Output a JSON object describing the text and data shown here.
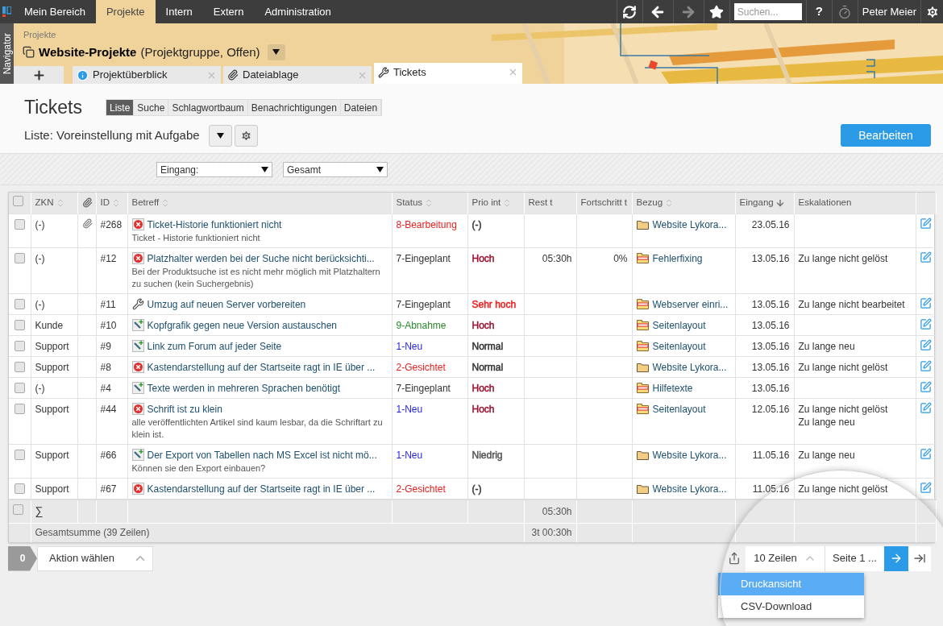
{
  "top_nav": {
    "items": [
      {
        "label": "Mein Bereich",
        "selected": false
      },
      {
        "label": "Projekte",
        "selected": true
      },
      {
        "label": "Intern",
        "selected": false
      },
      {
        "label": "Extern",
        "selected": false
      },
      {
        "label": "Administration",
        "selected": false
      }
    ],
    "forward_disabled": true,
    "timer_disabled": true,
    "search": {
      "placeholder": "Suchen..."
    },
    "help": "?",
    "user": "Peter Meier"
  },
  "navigator": "Navigator",
  "header": {
    "breadcrumb": "Projekte",
    "title": "Website-Projekte",
    "subtitle": "(Projektgruppe, Offen)",
    "tabs": [
      {
        "kind": "info",
        "label": "Projektüberblick",
        "selected": false
      },
      {
        "kind": "clip",
        "label": "Dateiablage",
        "selected": false
      },
      {
        "kind": "tools",
        "label": "Tickets",
        "selected": true
      }
    ]
  },
  "page": {
    "title": "Tickets",
    "view_tabs": [
      {
        "label": "Liste",
        "selected": true
      },
      {
        "label": "Suche",
        "selected": false
      },
      {
        "label": "Schlagwortbaum",
        "selected": false
      },
      {
        "label": "Benachrichtigungen",
        "selected": false
      },
      {
        "label": "Dateien",
        "selected": false
      }
    ],
    "list_label": "Liste: Voreinstellung mit Aufgabe",
    "edit_button": "Bearbeiten",
    "filters": [
      "Eingang:",
      "Gesamt"
    ]
  },
  "table": {
    "all_checked": false,
    "columns": [
      {
        "kind": "check"
      },
      {
        "kind": "sortable",
        "label": "ZKN",
        "sorted": false
      },
      {
        "kind": "clip"
      },
      {
        "kind": "sortable",
        "label": "ID",
        "sorted": false
      },
      {
        "kind": "sortable",
        "label": "Betreff",
        "sorted": false
      },
      {
        "kind": "sortable",
        "label": "Status",
        "sorted": false
      },
      {
        "kind": "sortable",
        "label": "Prio int",
        "sorted": false
      },
      {
        "kind": "text",
        "label": "Rest t"
      },
      {
        "kind": "text",
        "label": "Fortschritt t"
      },
      {
        "kind": "sortable",
        "label": "Bezug",
        "sorted": false
      },
      {
        "kind": "sortable",
        "label": "Eingang",
        "sorted": true
      },
      {
        "kind": "text",
        "label": "Eskalationen"
      },
      {
        "kind": "edit"
      }
    ],
    "rows": [
      {
        "checked": false,
        "zkn": "(-)",
        "attachment": true,
        "id": "#268",
        "kind": "error",
        "title": "Ticket-Historie funktioniert nicht",
        "description": "Ticket - Historie funktioniert nicht",
        "status": {
          "text": "8-Bearbeitung",
          "color": "#e8201f"
        },
        "prio": {
          "text": "(-)",
          "color": "#333333"
        },
        "bezug": {
          "kind": "folder",
          "text": "Website Lykora..."
        },
        "eingang": "23.05.16",
        "eskalationen": []
      },
      {
        "checked": false,
        "zkn": "(-)",
        "attachment": false,
        "id": "#12",
        "kind": "error",
        "title": "Platzhalter werden bei der Suche nicht berücksichti...",
        "description": "Bei der Produktsuche ist es nicht mehr möglich mit Platzhaltern zu suchen (kein Suchergebnis)",
        "status": {
          "text": "7-Eingeplant",
          "color": "#333333"
        },
        "prio": {
          "text": "Hoch",
          "color": "#9b1230"
        },
        "rest": "05:30h",
        "progress": "0%",
        "bezug": {
          "kind": "project",
          "text": "Fehlerfixing"
        },
        "eingang": "13.05.16",
        "eskalationen": [
          "Zu lange nicht gelöst"
        ]
      },
      {
        "checked": false,
        "zkn": "(-)",
        "attachment": false,
        "id": "#11",
        "kind": "tools",
        "title": "Umzug auf neuen Server vorbereiten",
        "status": {
          "text": "7-Eingeplant",
          "color": "#333333"
        },
        "prio": {
          "text": "Sehr hoch",
          "color": "#f0201f"
        },
        "bezug": {
          "kind": "project",
          "text": "Webserver einri..."
        },
        "eingang": "13.05.16",
        "eskalationen": [
          "Zu lange nicht bearbeitet"
        ]
      },
      {
        "checked": false,
        "zkn": "Kunde",
        "attachment": false,
        "id": "#10",
        "kind": "task",
        "title": "Kopfgrafik gegen neue Version austauschen",
        "status": {
          "text": "9-Abnahme",
          "color": "#2a8a2a"
        },
        "prio": {
          "text": "Hoch",
          "color": "#9b1230"
        },
        "bezug": {
          "kind": "project",
          "text": "Seitenlayout"
        },
        "eingang": "13.05.16",
        "eskalationen": []
      },
      {
        "checked": false,
        "zkn": "Support",
        "attachment": false,
        "id": "#9",
        "kind": "task",
        "title": "Link zum Forum auf jeder Seite",
        "status": {
          "text": "1-Neu",
          "color": "#1f1fe8"
        },
        "prio": {
          "text": "Normal",
          "color": "#333333"
        },
        "bezug": {
          "kind": "project",
          "text": "Seitenlayout"
        },
        "eingang": "13.05.16",
        "eskalationen": [
          "Zu lange neu"
        ]
      },
      {
        "checked": false,
        "zkn": "Support",
        "attachment": false,
        "id": "#8",
        "kind": "error",
        "title": "Kastendarstellung auf der Startseite ragt in IE über ...",
        "status": {
          "text": "2-Gesichtet",
          "color": "#e8201f"
        },
        "prio": {
          "text": "Normal",
          "color": "#333333"
        },
        "bezug": {
          "kind": "folder",
          "text": "Website Lykora..."
        },
        "eingang": "13.05.16",
        "eskalationen": [
          "Zu lange nicht gelöst"
        ]
      },
      {
        "checked": false,
        "zkn": "(-)",
        "attachment": false,
        "id": "#4",
        "kind": "task",
        "title": "Texte werden in mehreren Sprachen benötigt",
        "status": {
          "text": "7-Eingeplant",
          "color": "#333333"
        },
        "prio": {
          "text": "Hoch",
          "color": "#9b1230"
        },
        "bezug": {
          "kind": "project",
          "text": "Hilfetexte"
        },
        "eingang": "13.05.16",
        "eskalationen": []
      },
      {
        "checked": false,
        "zkn": "Support",
        "attachment": false,
        "id": "#44",
        "kind": "error",
        "title": "Schrift ist zu klein",
        "description": "alle veröffentlichten Artikel sind kaum lesbar, da die Schriftart zu klein ist.",
        "status": {
          "text": "1-Neu",
          "color": "#1f1fe8"
        },
        "prio": {
          "text": "Hoch",
          "color": "#9b1230"
        },
        "bezug": {
          "kind": "project",
          "text": "Seitenlayout"
        },
        "eingang": "12.05.16",
        "eskalationen": [
          "Zu lange nicht gelöst",
          "Zu lange neu"
        ]
      },
      {
        "checked": false,
        "zkn": "Support",
        "attachment": false,
        "id": "#66",
        "kind": "task",
        "title": "Der Export von Tabellen nach MS Excel ist nicht mö...",
        "description": "Können sie den Export einbauen?",
        "status": {
          "text": "1-Neu",
          "color": "#1f1fe8"
        },
        "prio": {
          "text": "Niedrig",
          "color": "#555555"
        },
        "bezug": {
          "kind": "folder",
          "text": "Website Lykora..."
        },
        "eingang": "11.05.16",
        "eskalationen": [
          "Zu lange neu"
        ]
      },
      {
        "checked": false,
        "zkn": "Support",
        "attachment": false,
        "id": "#67",
        "kind": "error",
        "title": "Kastendarstellung auf der Startseite ragt in IE über ...",
        "status": {
          "text": "2-Gesichtet",
          "color": "#e8201f"
        },
        "prio": {
          "text": "(-)",
          "color": "#333333"
        },
        "bezug": {
          "kind": "folder",
          "text": "Website Lykora..."
        },
        "eingang": "11.05.16",
        "eskalationen": [
          "Zu lange nicht gelöst"
        ]
      }
    ],
    "sum_row": {
      "checked": false,
      "symbol": "∑",
      "rest": "05:30h"
    },
    "total_row": {
      "label": "Gesamtsumme (39 Zeilen)",
      "rest": "3t 00:30h"
    }
  },
  "footer": {
    "count": "0",
    "action": "Aktion wählen",
    "page_size": "10 Zeilen",
    "page": "Seite 1 ...",
    "menu": [
      {
        "label": "Druckansicht",
        "selected": true
      },
      {
        "label": "CSV-Download",
        "selected": false
      }
    ]
  }
}
